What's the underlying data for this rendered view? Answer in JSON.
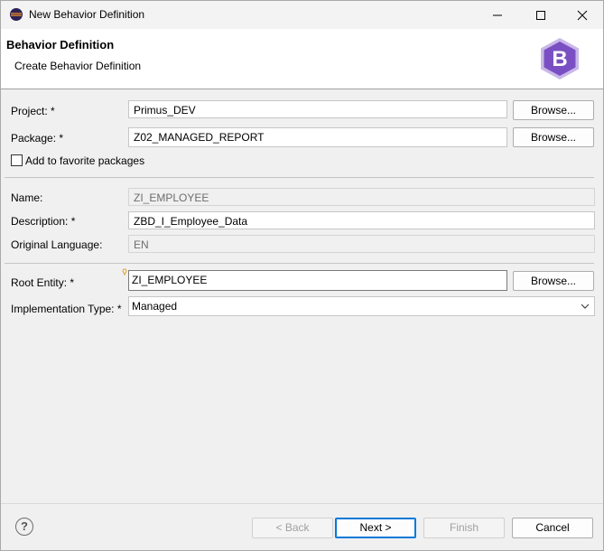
{
  "window": {
    "title": "New Behavior Definition"
  },
  "banner": {
    "title": "Behavior Definition",
    "subtitle": "Create Behavior Definition",
    "logo_letter": "B"
  },
  "form": {
    "project": {
      "label": "Project: *",
      "value": "Primus_DEV",
      "button": "Browse..."
    },
    "package": {
      "label": "Package: *",
      "value": "Z02_MANAGED_REPORT",
      "button": "Browse..."
    },
    "favorite": {
      "label": "Add to favorite packages",
      "checked": false
    },
    "name": {
      "label": "Name:",
      "value": "ZI_EMPLOYEE"
    },
    "description": {
      "label": "Description: *",
      "value": "ZBD_I_Employee_Data"
    },
    "original_language": {
      "label": "Original Language:",
      "value": "EN"
    },
    "root_entity": {
      "label": "Root Entity: *",
      "value": "ZI_EMPLOYEE",
      "button": "Browse..."
    },
    "implementation_type": {
      "label": "Implementation Type: *",
      "value": "Managed"
    }
  },
  "footer": {
    "back": "< Back",
    "next": "Next >",
    "finish": "Finish",
    "cancel": "Cancel"
  },
  "colors": {
    "accent": "#0078d7",
    "logo_fill": "#7b4fc4"
  }
}
